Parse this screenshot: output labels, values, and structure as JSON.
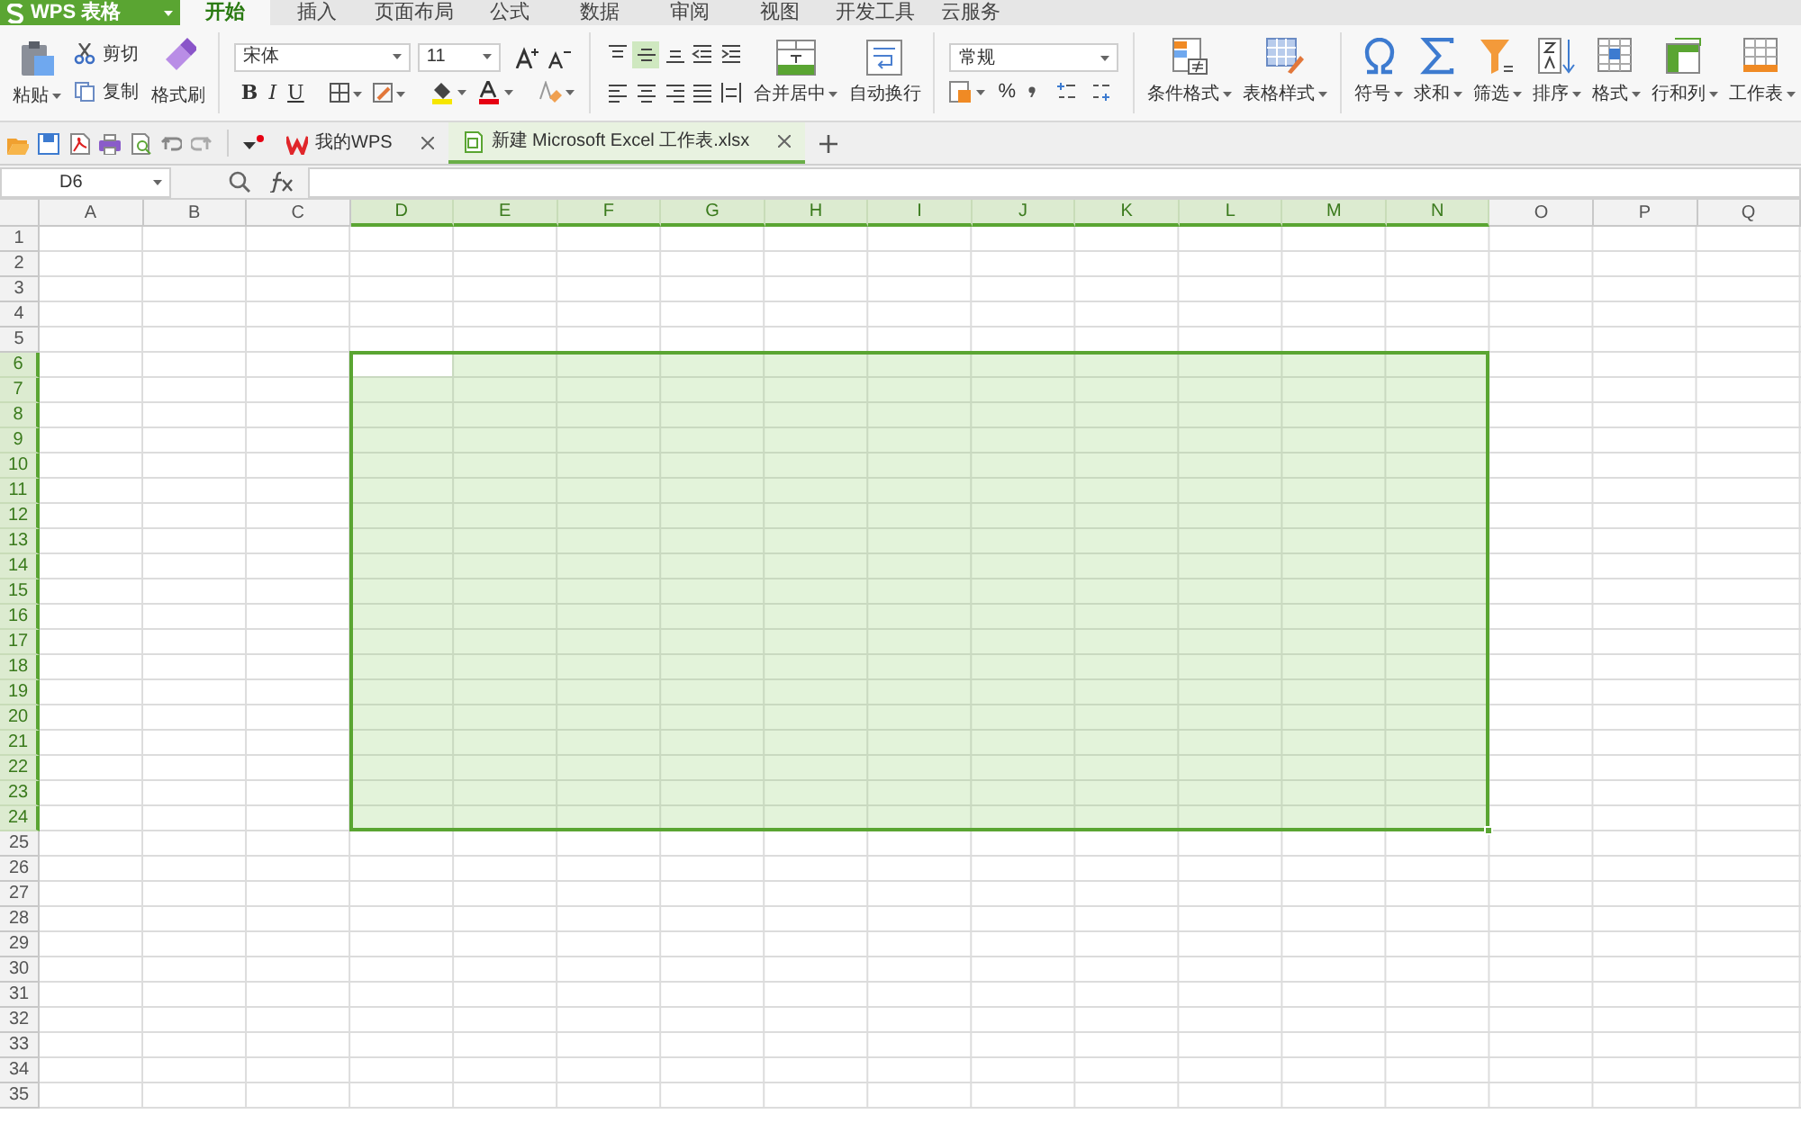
{
  "app_button": {
    "label": "WPS 表格"
  },
  "menu_tabs": [
    {
      "label": "开始",
      "selected": true
    },
    {
      "label": "插入",
      "selected": false
    },
    {
      "label": "页面布局",
      "selected": false
    },
    {
      "label": "公式",
      "selected": false
    },
    {
      "label": "数据",
      "selected": false
    },
    {
      "label": "审阅",
      "selected": false
    },
    {
      "label": "视图",
      "selected": false
    },
    {
      "label": "开发工具",
      "selected": false
    },
    {
      "label": "云服务",
      "selected": false
    }
  ],
  "clipboard": {
    "paste": "粘贴",
    "cut": "剪切",
    "copy": "复制",
    "format_painter": "格式刷"
  },
  "font": {
    "font_name": "宋体",
    "font_size": "11",
    "bold": "B",
    "italic": "I",
    "underline": "U"
  },
  "alignment_buttons": [
    {
      "kind": "align-top",
      "selected": false
    },
    {
      "kind": "align-middle",
      "selected": true
    },
    {
      "kind": "align-bottom",
      "selected": false
    },
    {
      "kind": "outdent",
      "selected": false
    },
    {
      "kind": "indent",
      "selected": false
    },
    {
      "kind": "align-left",
      "selected": false
    },
    {
      "kind": "align-center",
      "selected": false
    },
    {
      "kind": "align-right",
      "selected": false
    },
    {
      "kind": "justify",
      "selected": false
    },
    {
      "kind": "distribute",
      "selected": false
    }
  ],
  "merge_center": "合并居中",
  "wrap_text": "自动换行",
  "number": {
    "format": "常规",
    "percent": "%"
  },
  "large_buttons": [
    {
      "kind": "conditional-format",
      "label": "条件格式"
    },
    {
      "kind": "table-style",
      "label": "表格样式"
    },
    {
      "kind": "symbol",
      "label": "符号"
    },
    {
      "kind": "sum",
      "label": "求和"
    },
    {
      "kind": "filter",
      "label": "筛选"
    },
    {
      "kind": "sort",
      "label": "排序"
    },
    {
      "kind": "format",
      "label": "格式"
    },
    {
      "kind": "rows-columns",
      "label": "行和列"
    },
    {
      "kind": "worksheet",
      "label": "工作表"
    }
  ],
  "documents": [
    {
      "kind": "home",
      "label": "我的WPS",
      "selected": false
    },
    {
      "kind": "spreadsheet",
      "label": "新建 Microsoft Excel 工作表.xlsx",
      "selected": true
    }
  ],
  "name_box": "D6",
  "columns": [
    {
      "label": "A",
      "selected": false
    },
    {
      "label": "B",
      "selected": false
    },
    {
      "label": "C",
      "selected": false
    },
    {
      "label": "D",
      "selected": true
    },
    {
      "label": "E",
      "selected": true
    },
    {
      "label": "F",
      "selected": true
    },
    {
      "label": "G",
      "selected": true
    },
    {
      "label": "H",
      "selected": true
    },
    {
      "label": "I",
      "selected": true
    },
    {
      "label": "J",
      "selected": true
    },
    {
      "label": "K",
      "selected": true
    },
    {
      "label": "L",
      "selected": true
    },
    {
      "label": "M",
      "selected": true
    },
    {
      "label": "N",
      "selected": true
    },
    {
      "label": "O",
      "selected": false
    },
    {
      "label": "P",
      "selected": false
    },
    {
      "label": "Q",
      "selected": false
    }
  ],
  "rows": [
    {
      "label": "1",
      "selected": false
    },
    {
      "label": "2",
      "selected": false
    },
    {
      "label": "3",
      "selected": false
    },
    {
      "label": "4",
      "selected": false
    },
    {
      "label": "5",
      "selected": false
    },
    {
      "label": "6",
      "selected": true
    },
    {
      "label": "7",
      "selected": true
    },
    {
      "label": "8",
      "selected": true
    },
    {
      "label": "9",
      "selected": true
    },
    {
      "label": "10",
      "selected": true
    },
    {
      "label": "11",
      "selected": true
    },
    {
      "label": "12",
      "selected": true
    },
    {
      "label": "13",
      "selected": true
    },
    {
      "label": "14",
      "selected": true
    },
    {
      "label": "15",
      "selected": true
    },
    {
      "label": "16",
      "selected": true
    },
    {
      "label": "17",
      "selected": true
    },
    {
      "label": "18",
      "selected": true
    },
    {
      "label": "19",
      "selected": true
    },
    {
      "label": "20",
      "selected": true
    },
    {
      "label": "21",
      "selected": true
    },
    {
      "label": "22",
      "selected": true
    },
    {
      "label": "23",
      "selected": true
    },
    {
      "label": "24",
      "selected": true
    },
    {
      "label": "25",
      "selected": false
    },
    {
      "label": "26",
      "selected": false
    },
    {
      "label": "27",
      "selected": false
    },
    {
      "label": "28",
      "selected": false
    },
    {
      "label": "29",
      "selected": false
    },
    {
      "label": "30",
      "selected": false
    },
    {
      "label": "31",
      "selected": false
    },
    {
      "label": "32",
      "selected": false
    },
    {
      "label": "33",
      "selected": false
    },
    {
      "label": "34",
      "selected": false
    },
    {
      "label": "35",
      "selected": false
    }
  ]
}
